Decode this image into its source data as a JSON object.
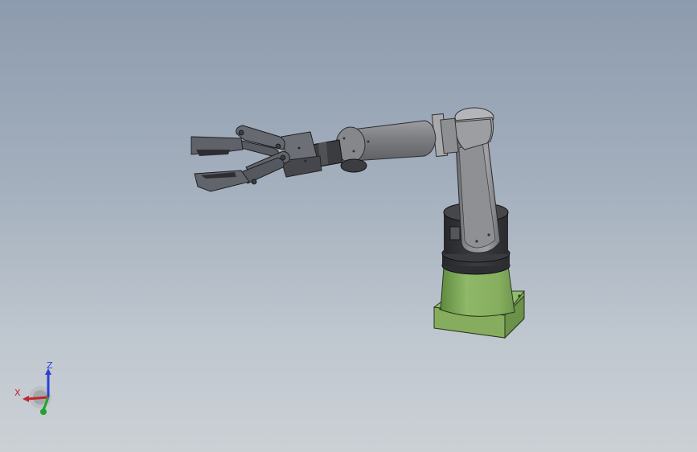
{
  "viewport": {
    "background_top": "#8d9bae",
    "background_bottom": "#cbd0d5"
  },
  "model": {
    "base_color": "#8bb063",
    "base_dark_color": "#6e9550",
    "joint_color": "#2e2f33",
    "link_color": "#77797d",
    "link_light_color": "#a9abae",
    "gripper_color": "#5d6066"
  },
  "triad": {
    "x_label": "X",
    "z_label": "Z",
    "x_color": "#c2262e",
    "z_color": "#2b3fd6",
    "y_color": "#21a32b"
  }
}
